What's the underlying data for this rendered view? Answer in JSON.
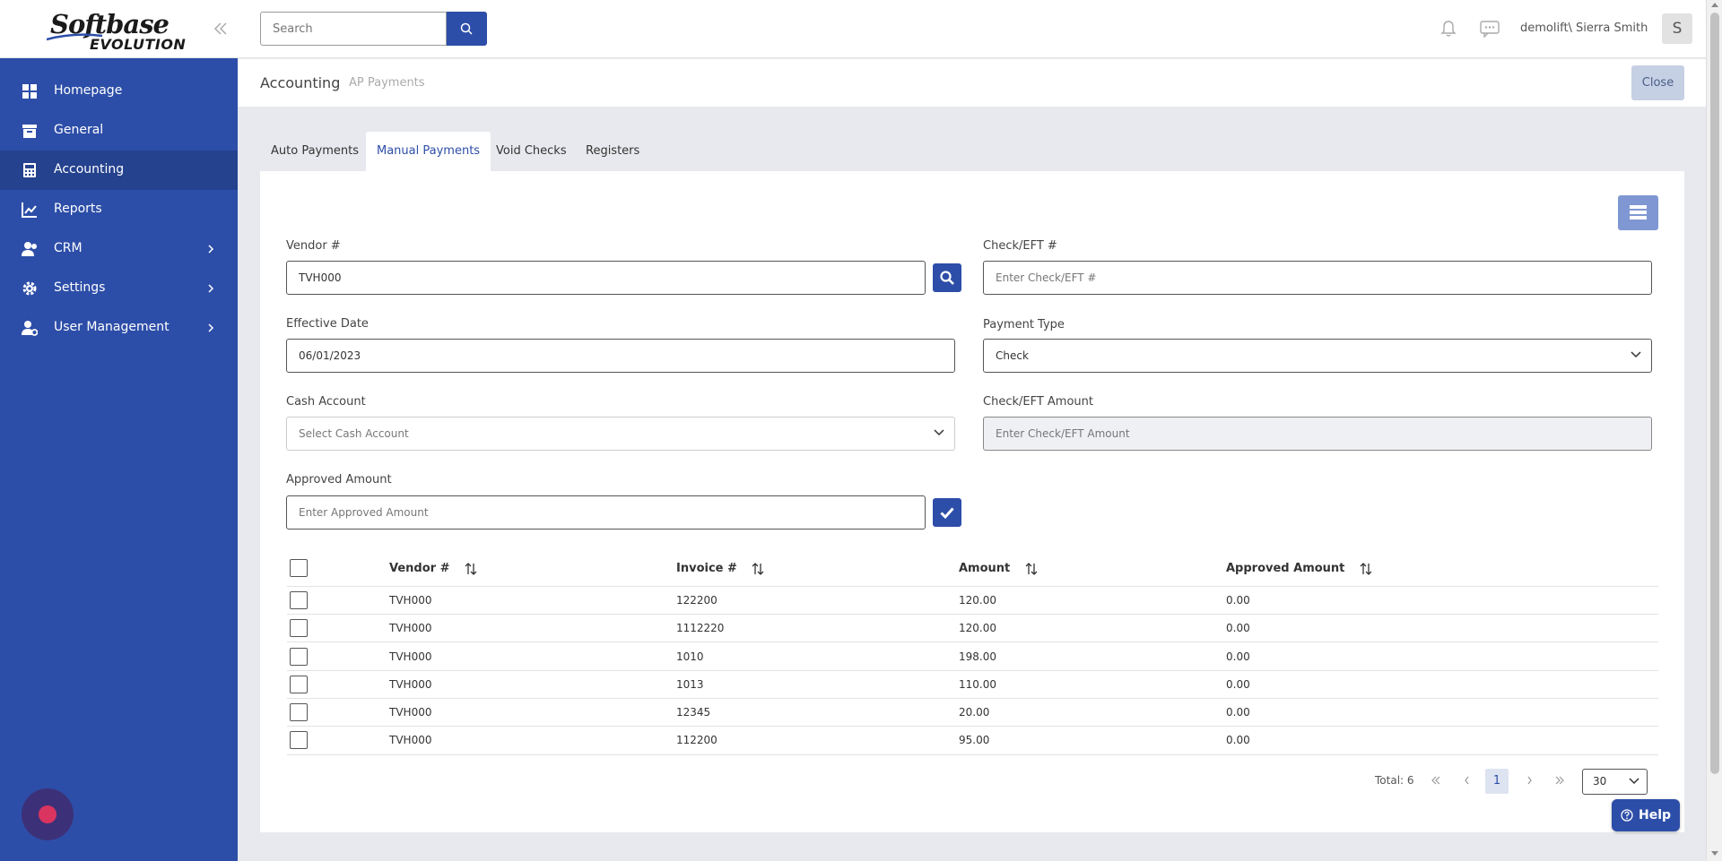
{
  "app": {
    "logo_text_top": "Softbase",
    "logo_text_bottom": "EVOLUTION",
    "brand_color": "#2d4ea8"
  },
  "sidebar": {
    "items": [
      {
        "label": "Homepage",
        "icon": "dashboard-icon"
      },
      {
        "label": "General",
        "icon": "archive-box-icon"
      },
      {
        "label": "Accounting",
        "icon": "calculator-icon",
        "active": true
      },
      {
        "label": "Reports",
        "icon": "line-chart-icon"
      },
      {
        "label": "CRM",
        "icon": "users-icon",
        "has_submenu": true
      },
      {
        "label": "Settings",
        "icon": "gear-icon",
        "has_submenu": true
      },
      {
        "label": "User Management",
        "icon": "user-gear-icon",
        "has_submenu": true
      }
    ]
  },
  "topbar": {
    "search_placeholder": "Search",
    "user_name": "demolift\\ Sierra Smith",
    "avatar_initial": "S"
  },
  "breadcrumb": {
    "section": "Accounting",
    "page": "AP Payments",
    "close_label": "Close"
  },
  "tabs": [
    "Auto Payments",
    "Manual Payments",
    "Void Checks",
    "Registers"
  ],
  "active_tab": "Manual Payments",
  "form": {
    "vendor_label": "Vendor #",
    "vendor_value": "TVH000",
    "check_label": "Check/EFT #",
    "check_placeholder": "Enter Check/EFT #",
    "effective_date_label": "Effective Date",
    "effective_date_value": "06/01/2023",
    "payment_type_label": "Payment Type",
    "payment_type_value": "Check",
    "cash_account_label": "Cash Account",
    "cash_account_placeholder": "Select Cash Account",
    "check_amount_label": "Check/EFT Amount",
    "check_amount_placeholder": "Enter Check/EFT Amount",
    "approved_amount_label": "Approved Amount",
    "approved_amount_placeholder": "Enter Approved Amount"
  },
  "table": {
    "columns": [
      "Vendor #",
      "Invoice #",
      "Amount",
      "Approved Amount"
    ],
    "rows": [
      [
        "TVH000",
        "122200",
        "120.00",
        "0.00"
      ],
      [
        "TVH000",
        "1112220",
        "120.00",
        "0.00"
      ],
      [
        "TVH000",
        "1010",
        "198.00",
        "0.00"
      ],
      [
        "TVH000",
        "1013",
        "110.00",
        "0.00"
      ],
      [
        "TVH000",
        "12345",
        "20.00",
        "0.00"
      ],
      [
        "TVH000",
        "112200",
        "95.00",
        "0.00"
      ]
    ]
  },
  "pager": {
    "total": "Total: 6",
    "current_page": "1",
    "page_size": "30"
  },
  "help_label": "Help"
}
